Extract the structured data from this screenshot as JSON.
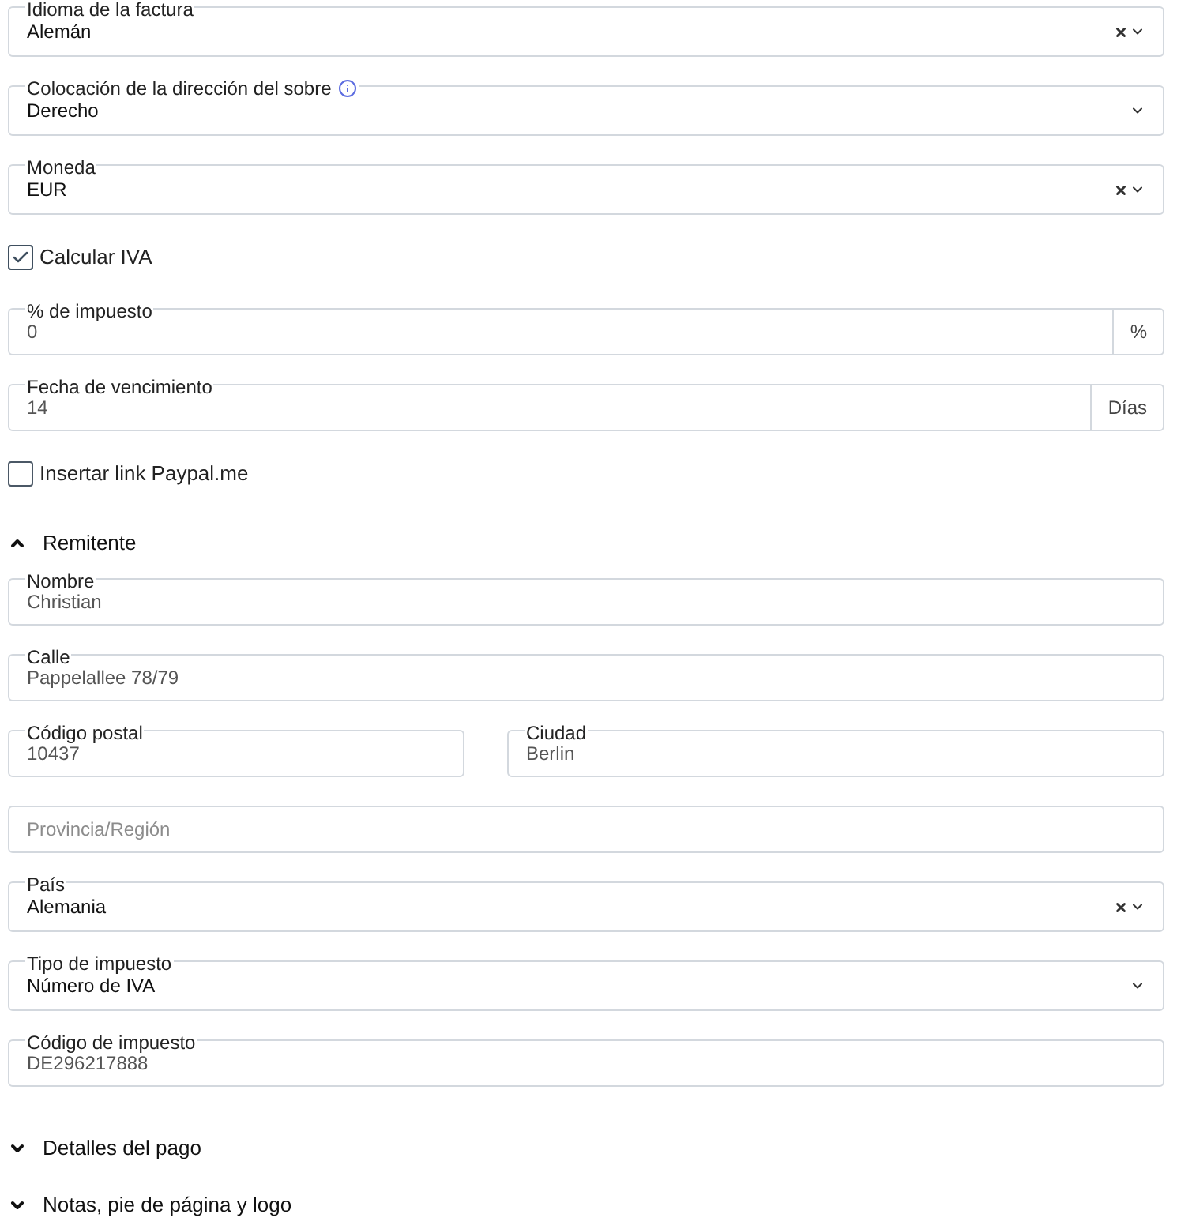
{
  "settings": [
    {
      "kind": "select",
      "label": "Idioma de la factura",
      "value": "Alemán",
      "clearable": true
    },
    {
      "kind": "select",
      "label": "Colocación de la dirección del sobre",
      "info": true,
      "value": "Derecho",
      "clearable": false
    },
    {
      "kind": "select",
      "label": "Moneda",
      "value": "EUR",
      "clearable": true
    },
    {
      "kind": "checkbox",
      "label": "Calcular IVA",
      "checked": true
    },
    {
      "kind": "input",
      "label": "% de impuesto",
      "value": "0",
      "suffix": "%"
    },
    {
      "kind": "input",
      "label": "Fecha de vencimiento",
      "value": "14",
      "suffix": "Días"
    },
    {
      "kind": "checkbox",
      "label": "Insertar link Paypal.me",
      "checked": false
    }
  ],
  "sections": [
    {
      "title": "Remitente",
      "expanded": true,
      "rows": [
        [
          {
            "kind": "input",
            "label": "Nombre",
            "value": "Christian"
          }
        ],
        [
          {
            "kind": "input",
            "label": "Calle",
            "value": "Pappelallee 78/79"
          }
        ],
        [
          {
            "kind": "input",
            "label": "Código postal",
            "value": "10437"
          },
          {
            "kind": "input",
            "label": "Ciudad",
            "value": "Berlin"
          }
        ],
        [
          {
            "kind": "input",
            "placeholder": "Provincia/Región"
          }
        ],
        [
          {
            "kind": "select",
            "label": "País",
            "value": "Alemania",
            "clearable": true
          }
        ],
        [
          {
            "kind": "select",
            "label": "Tipo de impuesto",
            "value": "Número de IVA",
            "clearable": false
          }
        ],
        [
          {
            "kind": "input",
            "label": "Código de impuesto",
            "value": "DE296217888"
          }
        ]
      ]
    },
    {
      "title": "Detalles del pago",
      "expanded": false
    },
    {
      "title": "Notas, pie de página y logo",
      "expanded": false
    }
  ]
}
